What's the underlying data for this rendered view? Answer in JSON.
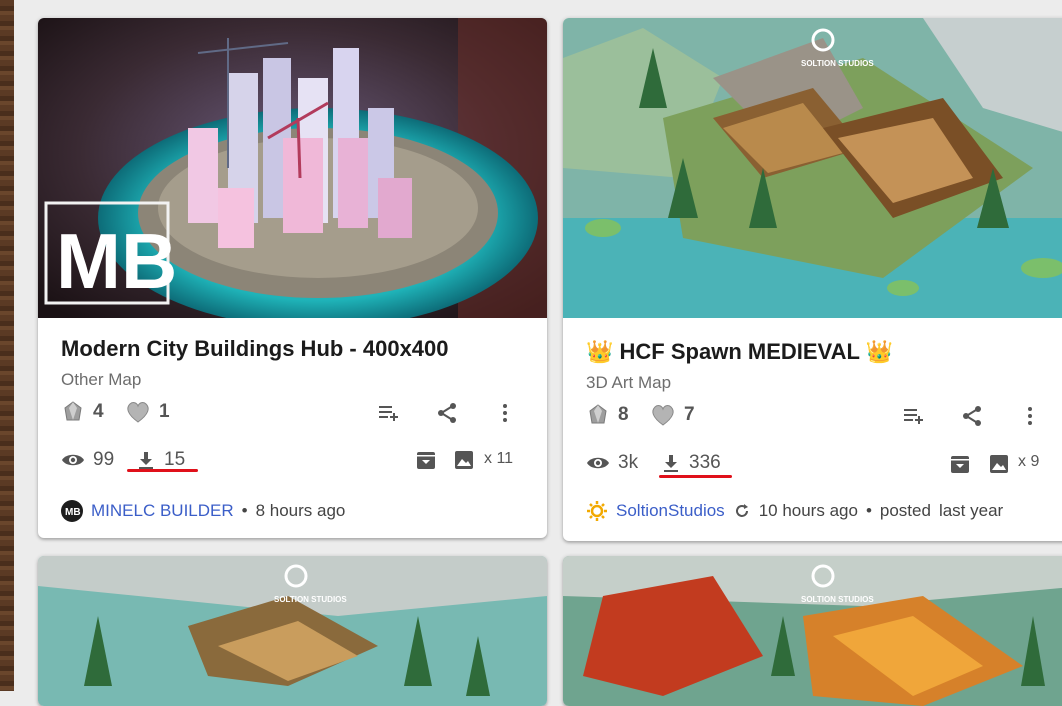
{
  "cards": [
    {
      "title": "Modern City Buildings Hub - 400x400",
      "category": "Other Map",
      "diamonds": "4",
      "likes": "1",
      "views": "99",
      "downloads": "15",
      "images_count": "x 11",
      "author": "MINELC BUILDER",
      "time": "8 hours ago",
      "logo_text": "MB"
    },
    {
      "title_prefix": "👑",
      "title": "HCF Spawn MEDIEVAL",
      "title_suffix": "👑",
      "category": "3D Art Map",
      "diamonds": "8",
      "likes": "7",
      "views": "3k",
      "downloads": "336",
      "images_count": "x 9",
      "author": "SoltionStudios",
      "updated": "10 hours ago",
      "posted_label": "posted",
      "posted": "last year",
      "watermark": "SOLTION STUDIOS"
    },
    {
      "watermark": "SOLTION STUDIOS"
    },
    {
      "watermark": "SOLTION STUDIOS"
    }
  ],
  "colors": {
    "accent_link": "#3b5ec8",
    "underline": "#e0101a"
  },
  "icons": [
    "diamond-icon",
    "heart-icon",
    "add-to-playlist-icon",
    "share-icon",
    "more-vert-icon",
    "eye-icon",
    "download-icon",
    "archive-icon",
    "image-icon",
    "refresh-icon",
    "sun-icon"
  ]
}
